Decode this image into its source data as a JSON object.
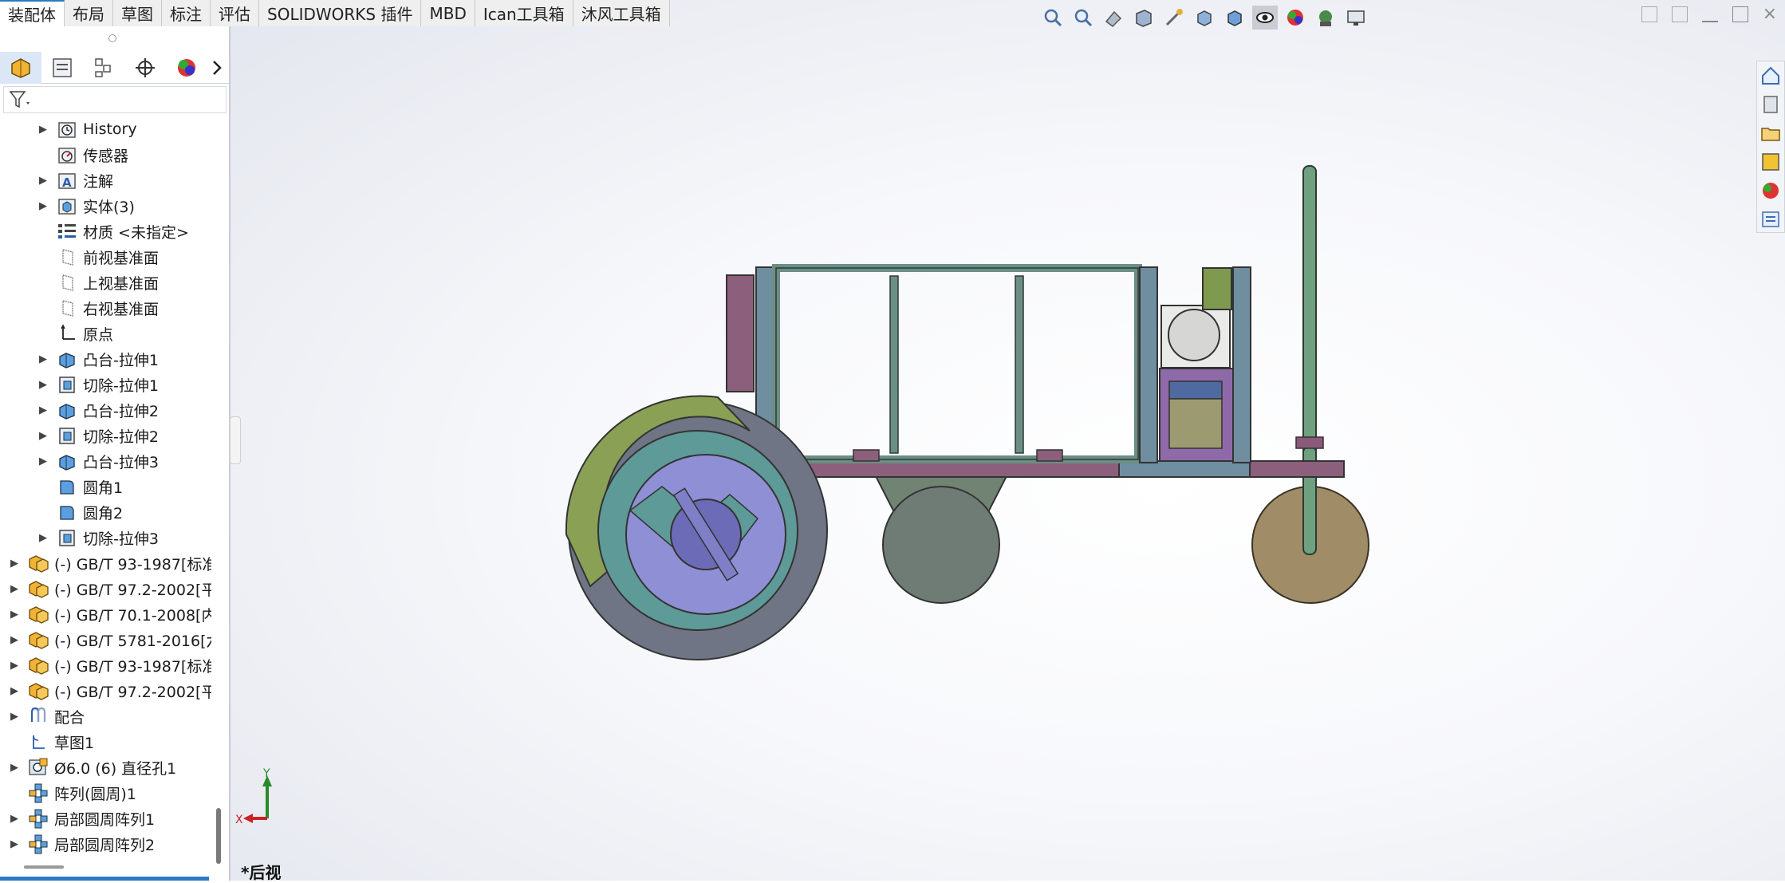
{
  "tabs": [
    "装配体",
    "布局",
    "草图",
    "标注",
    "评估",
    "SOLIDWORKS 插件",
    "MBD",
    "Ican工具箱",
    "沐风工具箱"
  ],
  "tree": [
    {
      "label": "History",
      "icon": "history-icon",
      "expand": true
    },
    {
      "label": "传感器",
      "icon": "sensor-icon",
      "expand": false
    },
    {
      "label": "注解",
      "icon": "annotation-icon",
      "expand": true
    },
    {
      "label": "实体(3)",
      "icon": "solid-bodies-icon",
      "expand": true
    },
    {
      "label": "材质 <未指定>",
      "icon": "material-icon",
      "expand": false
    },
    {
      "label": "前视基准面",
      "icon": "plane-icon",
      "expand": false
    },
    {
      "label": "上视基准面",
      "icon": "plane-icon",
      "expand": false
    },
    {
      "label": "右视基准面",
      "icon": "plane-icon",
      "expand": false
    },
    {
      "label": "原点",
      "icon": "origin-icon",
      "expand": false
    },
    {
      "label": "凸台-拉伸1",
      "icon": "boss-extrude-icon",
      "expand": true
    },
    {
      "label": "切除-拉伸1",
      "icon": "cut-extrude-icon",
      "expand": true
    },
    {
      "label": "凸台-拉伸2",
      "icon": "boss-extrude-icon",
      "expand": true
    },
    {
      "label": "切除-拉伸2",
      "icon": "cut-extrude-icon",
      "expand": true
    },
    {
      "label": "凸台-拉伸3",
      "icon": "boss-extrude-icon",
      "expand": true
    },
    {
      "label": "圆角1",
      "icon": "fillet-icon",
      "expand": false
    },
    {
      "label": "圆角2",
      "icon": "fillet-icon",
      "expand": false
    },
    {
      "label": "切除-拉伸3",
      "icon": "cut-extrude-icon",
      "expand": true
    },
    {
      "label": "(-) GB/T 93-1987[标准",
      "icon": "toolbox-part-icon",
      "expand": true,
      "top": true
    },
    {
      "label": "(-) GB/T 97.2-2002[平",
      "icon": "toolbox-part-icon",
      "expand": true,
      "top": true
    },
    {
      "label": "(-) GB/T 70.1-2008[内",
      "icon": "toolbox-part-icon",
      "expand": true,
      "top": true
    },
    {
      "label": "(-) GB/T 5781-2016[六",
      "icon": "toolbox-part-icon",
      "expand": true,
      "top": true
    },
    {
      "label": "(-) GB/T 93-1987[标准",
      "icon": "toolbox-part-icon",
      "expand": true,
      "top": true
    },
    {
      "label": "(-) GB/T 97.2-2002[平",
      "icon": "toolbox-part-icon",
      "expand": true,
      "top": true
    },
    {
      "label": "配合",
      "icon": "mates-icon",
      "expand": true,
      "top": true
    },
    {
      "label": "草图1",
      "icon": "sketch-icon",
      "expand": false,
      "top": true
    },
    {
      "label": "Ø6.0 (6) 直径孔1",
      "icon": "hole-wizard-icon",
      "expand": true,
      "top": true
    },
    {
      "label": "阵列(圆周)1",
      "icon": "circular-pattern-icon",
      "expand": false,
      "top": true
    },
    {
      "label": "局部圆周阵列1",
      "icon": "circular-pattern-icon",
      "expand": true,
      "top": true
    },
    {
      "label": "局部圆周阵列2",
      "icon": "circular-pattern-icon",
      "expand": true,
      "top": true
    }
  ],
  "triad": {
    "x": "X",
    "y": "Y"
  },
  "view_label": "*后视"
}
